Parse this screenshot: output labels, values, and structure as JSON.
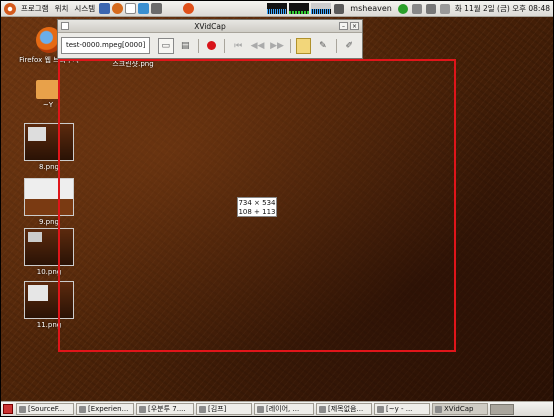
{
  "top_panel": {
    "menus": [
      "프로그램",
      "위치",
      "시스템"
    ],
    "user": "msheaven",
    "clock": "화 11월 2일 (금) 오후 08:48"
  },
  "desktop": {
    "icons": [
      {
        "label": "Firefox 웹 브라우저"
      },
      {
        "label": "스크린샷.png"
      },
      {
        "label": "~Y"
      },
      {
        "label": "8.png"
      },
      {
        "label": "9.png"
      },
      {
        "label": "10.png"
      },
      {
        "label": "11.png"
      }
    ],
    "selection": {
      "size": "734 × 534",
      "offset": "108 + 113"
    }
  },
  "xvidcap": {
    "title": "XVidCap",
    "filename": "test-0000.mpeg[0000]"
  },
  "taskbar": {
    "tasks": [
      "[SourceF...",
      "[Experien...",
      "[우분투 7....",
      "[김프]",
      "[레이어, ...",
      "[제목없음...",
      "[~y - ...",
      "XVidCap"
    ]
  },
  "colors": {
    "selection": "#e0151a",
    "record": "#d8141a",
    "wallpaper": "#4a2208"
  }
}
